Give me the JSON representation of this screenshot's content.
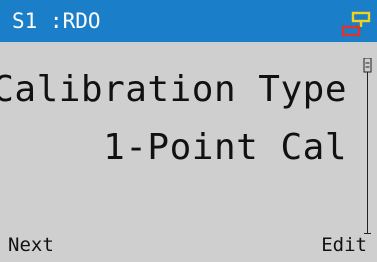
{
  "header": {
    "title": "S1 :RDO",
    "status_icon": "network-connection-icon",
    "colors": {
      "bar": "#1a7ec8",
      "icon_top": "#f2d21a",
      "icon_bottom": "#e0332e"
    }
  },
  "main": {
    "heading": "Calibration Type",
    "value": "1-Point Cal"
  },
  "softkeys": {
    "left": "Next",
    "right": "Edit"
  },
  "scrollbar": {
    "position": 0.0
  }
}
